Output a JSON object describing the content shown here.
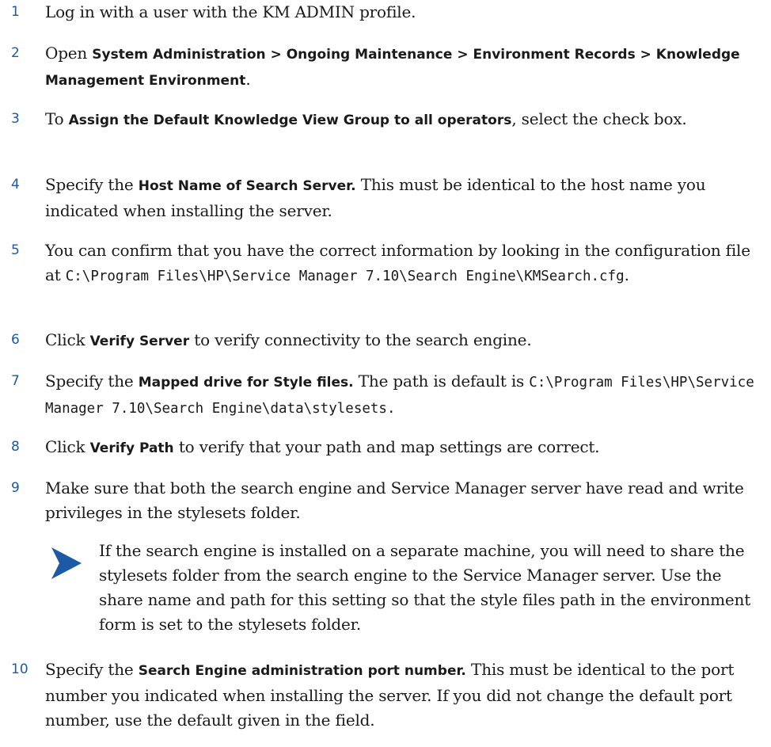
{
  "steps": [
    {
      "number": "1",
      "parts": [
        {
          "t": "Log in with a user with the KM ADMIN profile."
        }
      ]
    },
    {
      "number": "2",
      "parts": [
        {
          "t": "Open "
        },
        {
          "t": "System Administration > Ongoing Maintenance > Environment Records > Knowledge Management Environment",
          "s": "b"
        },
        {
          "t": "."
        }
      ]
    },
    {
      "number": "3",
      "parts": [
        {
          "t": "To "
        },
        {
          "t": "Assign the Default Knowledge View Group to all operators",
          "s": "b"
        },
        {
          "t": ", select the check box."
        }
      ]
    },
    {
      "number": "4",
      "parts": [
        {
          "t": "Specify the "
        },
        {
          "t": "Host Name of Search Server.",
          "s": "b"
        },
        {
          "t": " This must be identical to the host name you indicated when installing the server."
        }
      ]
    },
    {
      "number": "5",
      "parts": [
        {
          "t": "You can confirm that you have the correct information by looking in the configuration file at "
        },
        {
          "t": "C:\\Program Files\\HP\\Service Manager 7.10\\Search Engine\\KMSearch.cfg",
          "s": "mono"
        },
        {
          "t": "."
        }
      ]
    },
    {
      "number": "6",
      "parts": [
        {
          "t": "Click "
        },
        {
          "t": "Verify Server",
          "s": "b"
        },
        {
          "t": " to verify connectivity to the search engine."
        }
      ]
    },
    {
      "number": "7",
      "parts": [
        {
          "t": "Specify the "
        },
        {
          "t": "Mapped drive for Style files.",
          "s": "b"
        },
        {
          "t": " The path is default is "
        },
        {
          "t": "C:\\Program Files\\HP\\Service Manager 7.10\\Search Engine\\data\\stylesets.",
          "s": "mono"
        }
      ]
    },
    {
      "number": "8",
      "parts": [
        {
          "t": "Click "
        },
        {
          "t": "Verify Path",
          "s": "b"
        },
        {
          "t": " to verify that your path and map settings are correct."
        }
      ]
    },
    {
      "number": "9",
      "parts": [
        {
          "t": "Make sure that both the search engine and Service Manager server have read and write privileges in the stylesets folder."
        }
      ]
    },
    {
      "number": "10",
      "parts": [
        {
          "t": "Specify the "
        },
        {
          "t": "Search Engine administration port number.",
          "s": "b"
        },
        {
          "t": " This must be identical to the port number you indicated when installing the server. If you did not change the default port number, use the default given in the field."
        }
      ]
    }
  ],
  "note": {
    "icon": "note-arrow-icon",
    "icon_color": "#1c5aa6",
    "text": "If the search engine is installed on a separate machine, you will need to share the stylesets folder from the search engine to the Service Manager server. Use the share name and path for this setting so that the style files path in the environment form is set to the stylesets folder."
  }
}
